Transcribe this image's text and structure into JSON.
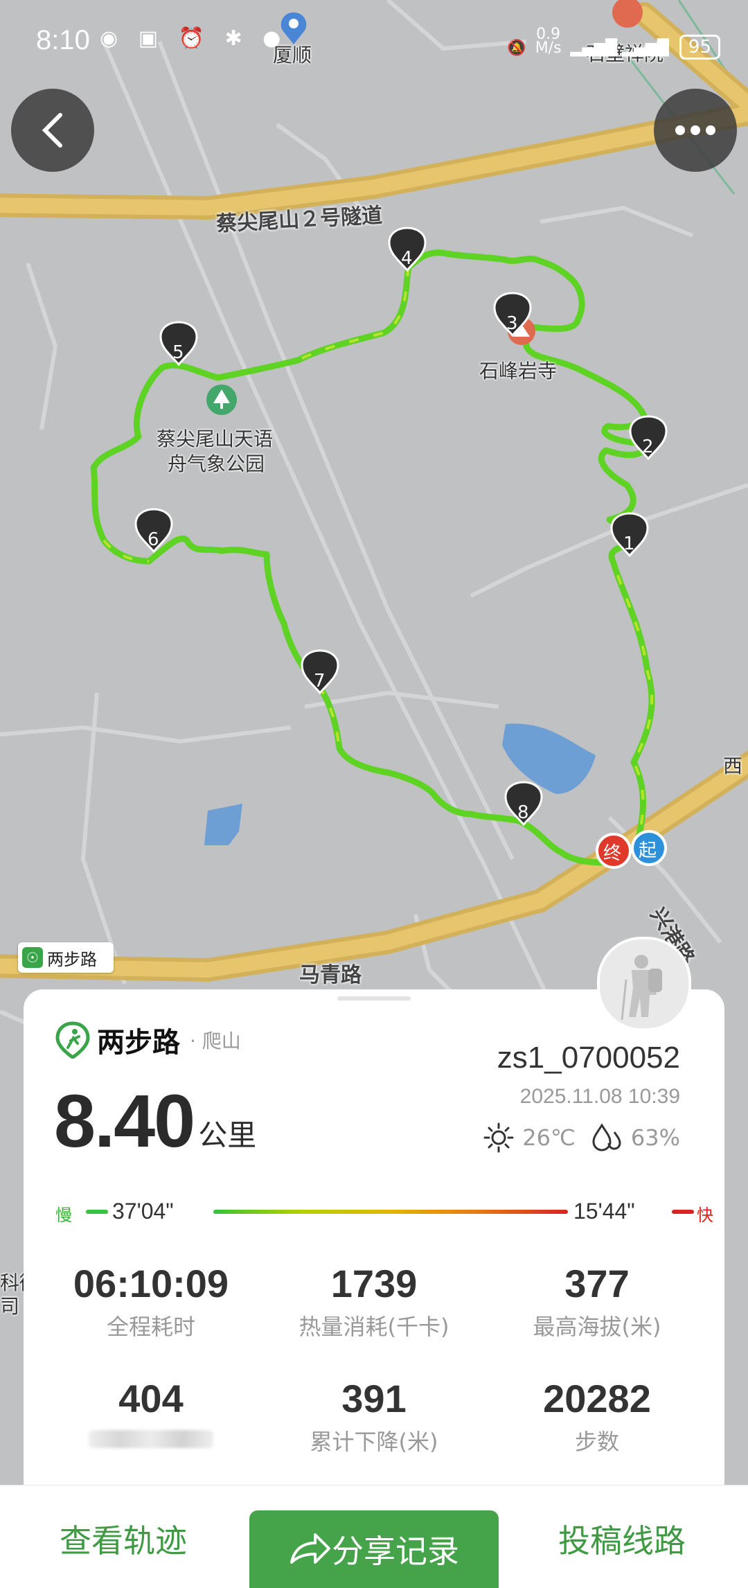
{
  "status_bar": {
    "time": "8:10",
    "net_speed": "0.9",
    "net_unit": "M/s",
    "battery": "95"
  },
  "map": {
    "poi_top": "厦顺",
    "poi_top_right": "石壁禅院",
    "road_tunnel": "蔡尖尾山２号隧道",
    "temple": "石峰岩寺",
    "park_line1": "蔡尖尾山天语",
    "park_line2": "舟气象公园",
    "road_bottom": "马青路",
    "road_right": "兴港路",
    "edge_right": "西",
    "edge_left_1": "科微",
    "edge_left_2": "司",
    "markers": [
      "1",
      "2",
      "3",
      "4",
      "5",
      "6",
      "7",
      "8"
    ],
    "end_label": "终",
    "start_label": "起"
  },
  "watermark": {
    "text": "两步路"
  },
  "summary": {
    "app_name": "两步路",
    "activity": "· 爬山",
    "username": "zs1_0700052",
    "datetime": "2025.11.08 10:39",
    "temperature": "26℃",
    "humidity": "63%",
    "distance": "8.40",
    "distance_unit": "公里",
    "pace_slow_label": "慢",
    "pace_fast_label": "快",
    "pace_slow": "37'04\"",
    "pace_fast": "15'44\"",
    "stats": [
      {
        "value": "06:10:09",
        "label": "全程耗时"
      },
      {
        "value": "1739",
        "label": "热量消耗(千卡)"
      },
      {
        "value": "377",
        "label": "最高海拔(米)"
      },
      {
        "value": "404",
        "label": ""
      },
      {
        "value": "391",
        "label": "累计下降(米)"
      },
      {
        "value": "20282",
        "label": "步数"
      }
    ]
  },
  "bottom_bar": {
    "view_track": "查看轨迹",
    "share": "分享记录",
    "submit_route": "投稿线路"
  }
}
